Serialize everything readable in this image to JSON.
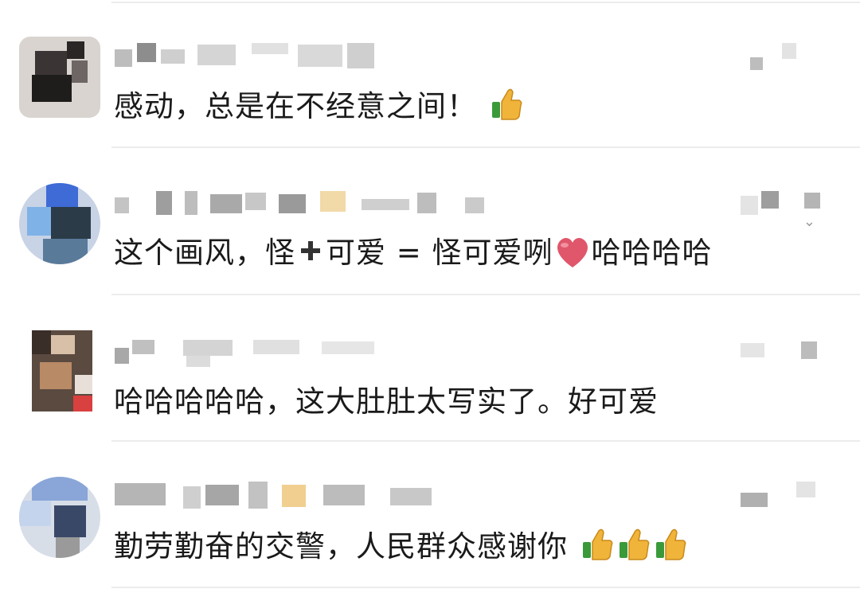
{
  "comments": [
    {
      "text": "感动，总是在不经意之间！",
      "emoji_suffix": [
        "thumbs-up-icon"
      ]
    },
    {
      "text_parts": [
        "这个画风，怪",
        "➕",
        "可爱 = 怪可爱咧",
        "哈哈哈哈"
      ],
      "emoji_inline": [
        "plus-icon",
        "heart-icon"
      ]
    },
    {
      "text": "哈哈哈哈哈，这大肚肚太写实了。好可爱",
      "emoji_suffix": []
    },
    {
      "text": "勤劳勤奋的交警，人民群众感谢你",
      "emoji_suffix": [
        "thumbs-up-icon",
        "thumbs-up-icon",
        "thumbs-up-icon"
      ]
    }
  ],
  "colors": {
    "text": "#1a1a1a",
    "divider": "#ececec",
    "background": "#ffffff",
    "heart": "#e0566a",
    "thumb": "#f0b43a"
  }
}
